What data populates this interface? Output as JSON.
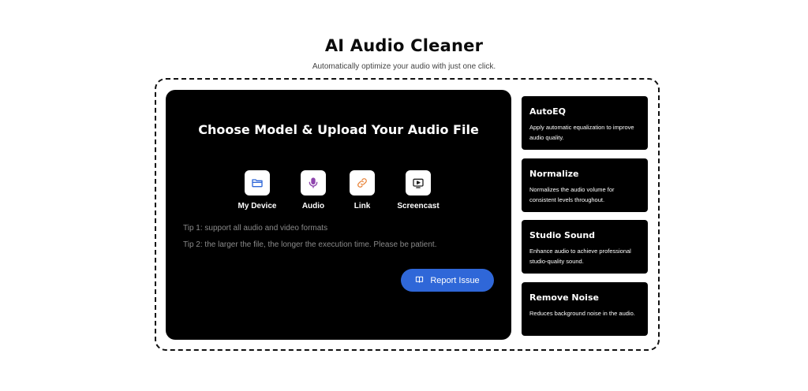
{
  "page": {
    "title": "AI Audio Cleaner",
    "subtitle": "Automatically optimize your audio with just one click."
  },
  "upload_panel": {
    "title": "Choose Model & Upload Your Audio File",
    "sources": [
      {
        "label": "My Device",
        "icon": "folder-icon",
        "color": "#2f67d8"
      },
      {
        "label": "Audio",
        "icon": "microphone-icon",
        "color": "#8e44ad"
      },
      {
        "label": "Link",
        "icon": "link-icon",
        "color": "#e8843a"
      },
      {
        "label": "Screencast",
        "icon": "screencast-icon",
        "color": "#222222"
      }
    ],
    "tips": [
      "Tip 1: support all audio and video formats",
      "Tip 2: the larger the file, the longer the execution time. Please be patient."
    ],
    "report_button": "Report Issue"
  },
  "models": [
    {
      "title": "AutoEQ",
      "description": "Apply automatic equalization to improve audio quality."
    },
    {
      "title": "Normalize",
      "description": "Normalizes the audio volume for consistent levels throughout."
    },
    {
      "title": "Studio Sound",
      "description": "Enhance audio to achieve professional studio-quality sound."
    },
    {
      "title": "Remove Noise",
      "description": "Reduces background noise in the audio."
    }
  ],
  "colors": {
    "accent": "#2f67d8",
    "panel": "#000000",
    "background": "#ffffff"
  }
}
